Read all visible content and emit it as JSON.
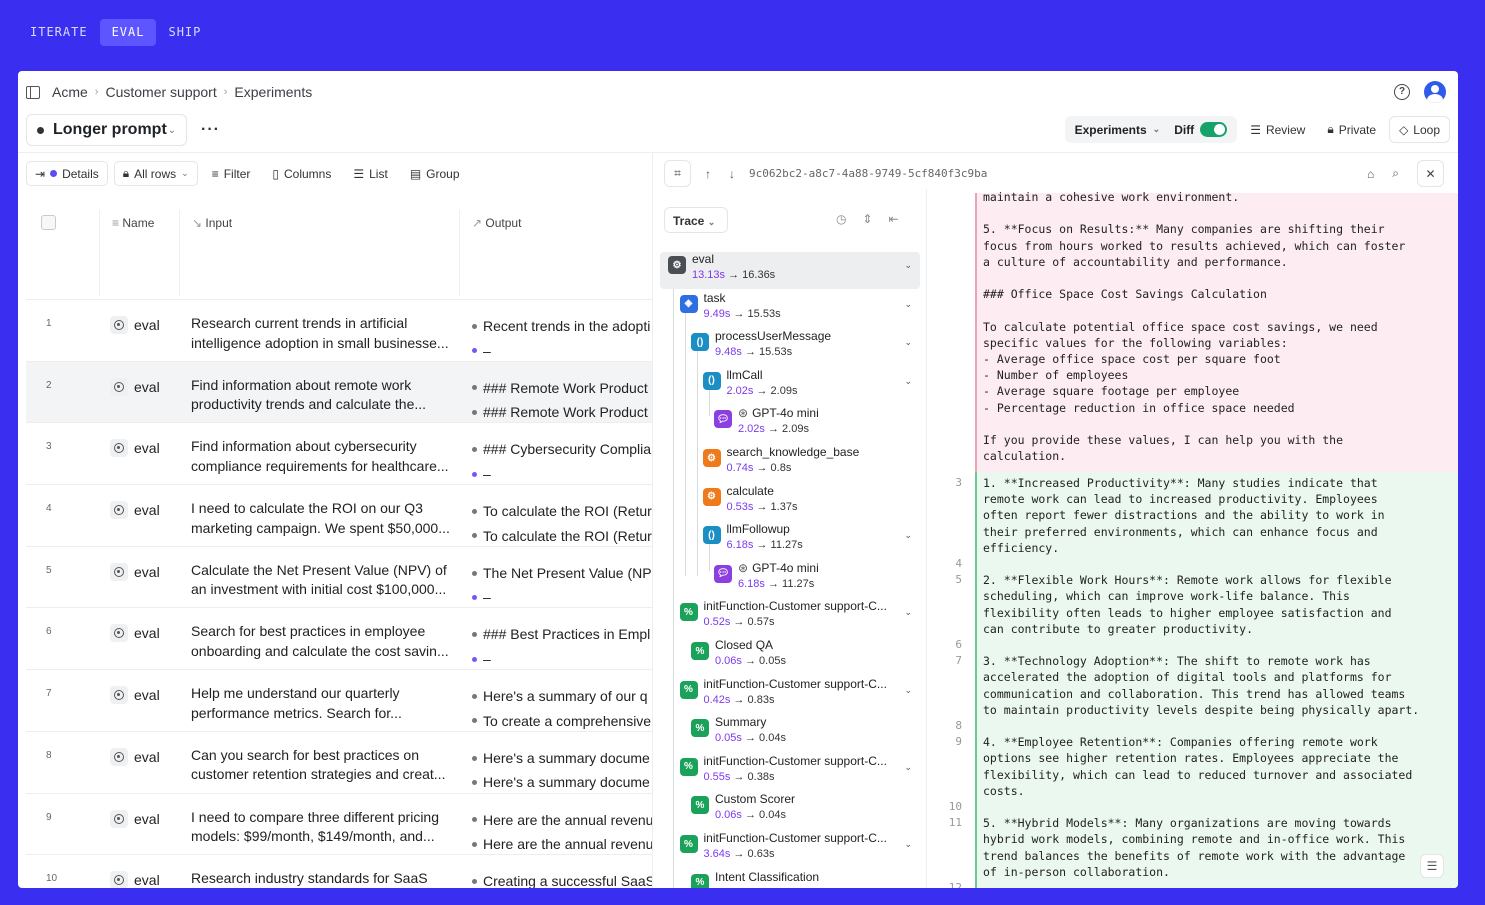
{
  "topnav": [
    "ITERATE",
    "EVAL",
    "SHIP"
  ],
  "breadcrumb": [
    "Acme",
    "Customer support",
    "Experiments"
  ],
  "experiment_name": "Longer prompt",
  "right_bar": {
    "experiments": "Experiments",
    "diff": "Diff",
    "review": "Review",
    "private": "Private",
    "loop": "Loop"
  },
  "toolbar": {
    "details": "Details",
    "all_rows": "All rows",
    "filter": "Filter",
    "columns": "Columns",
    "list": "List",
    "group": "Group"
  },
  "columns": {
    "name": "Name",
    "input": "Input",
    "output": "Output"
  },
  "rows": [
    {
      "n": "1",
      "name": "eval",
      "input": "Research current trends in artificial intelligence adoption in small businesse...",
      "out1": "Recent trends in the adopti",
      "out2": "–",
      "out2_dot": "purple"
    },
    {
      "n": "2",
      "name": "eval",
      "input": "Find information about remote work productivity trends and calculate the...",
      "out1": "### Remote Work Product",
      "out2": "### Remote Work Product",
      "out2_dot": "gray"
    },
    {
      "n": "3",
      "name": "eval",
      "input": "Find information about cybersecurity compliance requirements for healthcare...",
      "out1": "### Cybersecurity Complia",
      "out2": "–",
      "out2_dot": "purple"
    },
    {
      "n": "4",
      "name": "eval",
      "input": "I need to calculate the ROI on our Q3 marketing campaign. We spent $50,000...",
      "out1": "To calculate the ROI (Retur",
      "out2": "To calculate the ROI (Retur",
      "out2_dot": "gray"
    },
    {
      "n": "5",
      "name": "eval",
      "input": "Calculate the Net Present Value (NPV) of an investment with initial cost $100,000...",
      "out1": "The Net Present Value (NP",
      "out2": "–",
      "out2_dot": "purple"
    },
    {
      "n": "6",
      "name": "eval",
      "input": "Search for best practices in employee onboarding and calculate the cost savin...",
      "out1": "### Best Practices in Empl",
      "out2": "–",
      "out2_dot": "purple"
    },
    {
      "n": "7",
      "name": "eval",
      "input": "Help me understand our quarterly performance metrics. Search for...",
      "out1": "Here's a summary of our q",
      "out2": "To create a comprehensive",
      "out2_dot": "gray"
    },
    {
      "n": "8",
      "name": "eval",
      "input": "Can you search for best practices on customer retention strategies and creat...",
      "out1": "Here's a summary docume",
      "out2": "Here's a summary docume",
      "out2_dot": "gray"
    },
    {
      "n": "9",
      "name": "eval",
      "input": "I need to compare three different pricing models: $99/month, $149/month, and...",
      "out1": "Here are the annual revenu",
      "out2": "Here are the annual revenu",
      "out2_dot": "gray"
    },
    {
      "n": "10",
      "name": "eval",
      "input": "Research industry standards for SaaS",
      "out1": "Creating a successful SaaS",
      "out2": "",
      "out2_dot": "gray"
    }
  ],
  "trace_id": "9c062bc2-a8c7-4a88-9749-5cf840f3c9ba",
  "trace_label": "Trace",
  "spans": [
    {
      "name": "eval",
      "t1": "13.13s",
      "t2": "16.36s",
      "icon": "gear-icon",
      "color": "#4b4f55"
    },
    {
      "name": "task",
      "t1": "9.49s",
      "t2": "15.53s",
      "icon": "cube-icon",
      "color": "#2f6fe4"
    },
    {
      "name": "processUserMessage",
      "t1": "9.48s",
      "t2": "15.53s",
      "icon": "function-icon",
      "color": "#1b8fc4"
    },
    {
      "name": "llmCall",
      "t1": "2.02s",
      "t2": "2.09s",
      "icon": "function-icon",
      "color": "#1b8fc4"
    },
    {
      "name": "GPT-4o mini",
      "t1": "2.02s",
      "t2": "2.09s",
      "icon": "chat-icon",
      "color": "#8b3fe0"
    },
    {
      "name": "search_knowledge_base",
      "t1": "0.74s",
      "t2": "0.8s",
      "icon": "tool-icon",
      "color": "#ee7a1a"
    },
    {
      "name": "calculate",
      "t1": "0.53s",
      "t2": "1.37s",
      "icon": "tool-icon",
      "color": "#ee7a1a"
    },
    {
      "name": "llmFollowup",
      "t1": "6.18s",
      "t2": "11.27s",
      "icon": "function-icon",
      "color": "#1b8fc4"
    },
    {
      "name": "GPT-4o mini",
      "t1": "6.18s",
      "t2": "11.27s",
      "icon": "chat-icon",
      "color": "#8b3fe0"
    },
    {
      "name": "initFunction-Customer support-C...",
      "t1": "0.52s",
      "t2": "0.57s",
      "icon": "percent-icon",
      "color": "#1aa15a"
    },
    {
      "name": "Closed QA",
      "t1": "0.06s",
      "t2": "0.05s",
      "icon": "percent-icon",
      "color": "#1aa15a"
    },
    {
      "name": "initFunction-Customer support-C...",
      "t1": "0.42s",
      "t2": "0.83s",
      "icon": "percent-icon",
      "color": "#1aa15a"
    },
    {
      "name": "Summary",
      "t1": "0.05s",
      "t2": "0.04s",
      "icon": "percent-icon",
      "color": "#1aa15a"
    },
    {
      "name": "initFunction-Customer support-C...",
      "t1": "0.55s",
      "t2": "0.38s",
      "icon": "percent-icon",
      "color": "#1aa15a"
    },
    {
      "name": "Custom Scorer",
      "t1": "0.06s",
      "t2": "0.04s",
      "icon": "percent-icon",
      "color": "#1aa15a"
    },
    {
      "name": "initFunction-Customer support-C...",
      "t1": "3.64s",
      "t2": "0.63s",
      "icon": "percent-icon",
      "color": "#1aa15a"
    },
    {
      "name": "Intent Classification",
      "t1": "",
      "t2": "",
      "icon": "percent-icon",
      "color": "#1aa15a"
    }
  ],
  "diff_removed": [
    "maintain a cohesive work environment.",
    "",
    "5. **Focus on Results:** Many companies are shifting their",
    "focus from hours worked to results achieved, which can foster",
    "a culture of accountability and performance.",
    "",
    "### Office Space Cost Savings Calculation",
    "",
    "To calculate potential office space cost savings, we need",
    "specific values for the following variables:",
    "- Average office space cost per square foot",
    "- Number of employees",
    "- Average square footage per employee",
    "- Percentage reduction in office space needed",
    "",
    "If you provide these values, I can help you with the",
    "calculation."
  ],
  "diff_added": [
    {
      "ln": "3",
      "text": "1. **Increased Productivity**: Many studies indicate that"
    },
    {
      "ln": "",
      "text": "remote work can lead to increased productivity. Employees"
    },
    {
      "ln": "",
      "text": "often report fewer distractions and the ability to work in"
    },
    {
      "ln": "",
      "text": "their preferred environments, which can enhance focus and"
    },
    {
      "ln": "",
      "text": "efficiency."
    },
    {
      "ln": "4",
      "text": ""
    },
    {
      "ln": "5",
      "text": "2. **Flexible Work Hours**: Remote work allows for flexible"
    },
    {
      "ln": "",
      "text": "scheduling, which can improve work-life balance. This"
    },
    {
      "ln": "",
      "text": "flexibility often leads to higher employee satisfaction and"
    },
    {
      "ln": "",
      "text": "can contribute to greater productivity."
    },
    {
      "ln": "6",
      "text": ""
    },
    {
      "ln": "7",
      "text": "3. **Technology Adoption**: The shift to remote work has"
    },
    {
      "ln": "",
      "text": "accelerated the adoption of digital tools and platforms for"
    },
    {
      "ln": "",
      "text": "communication and collaboration. This trend has allowed teams"
    },
    {
      "ln": "",
      "text": "to maintain productivity levels despite being physically apart."
    },
    {
      "ln": "8",
      "text": ""
    },
    {
      "ln": "9",
      "text": "4. **Employee Retention**: Companies offering remote work"
    },
    {
      "ln": "",
      "text": "options see higher retention rates. Employees appreciate the"
    },
    {
      "ln": "",
      "text": "flexibility, which can lead to reduced turnover and associated"
    },
    {
      "ln": "",
      "text": "costs."
    },
    {
      "ln": "10",
      "text": ""
    },
    {
      "ln": "11",
      "text": "5. **Hybrid Models**: Many organizations are moving towards"
    },
    {
      "ln": "",
      "text": "hybrid work models, combining remote and in-office work. This"
    },
    {
      "ln": "",
      "text": "trend balances the benefits of remote work with the advantage"
    },
    {
      "ln": "",
      "text": "of in-person collaboration."
    },
    {
      "ln": "12",
      "text": ""
    }
  ]
}
